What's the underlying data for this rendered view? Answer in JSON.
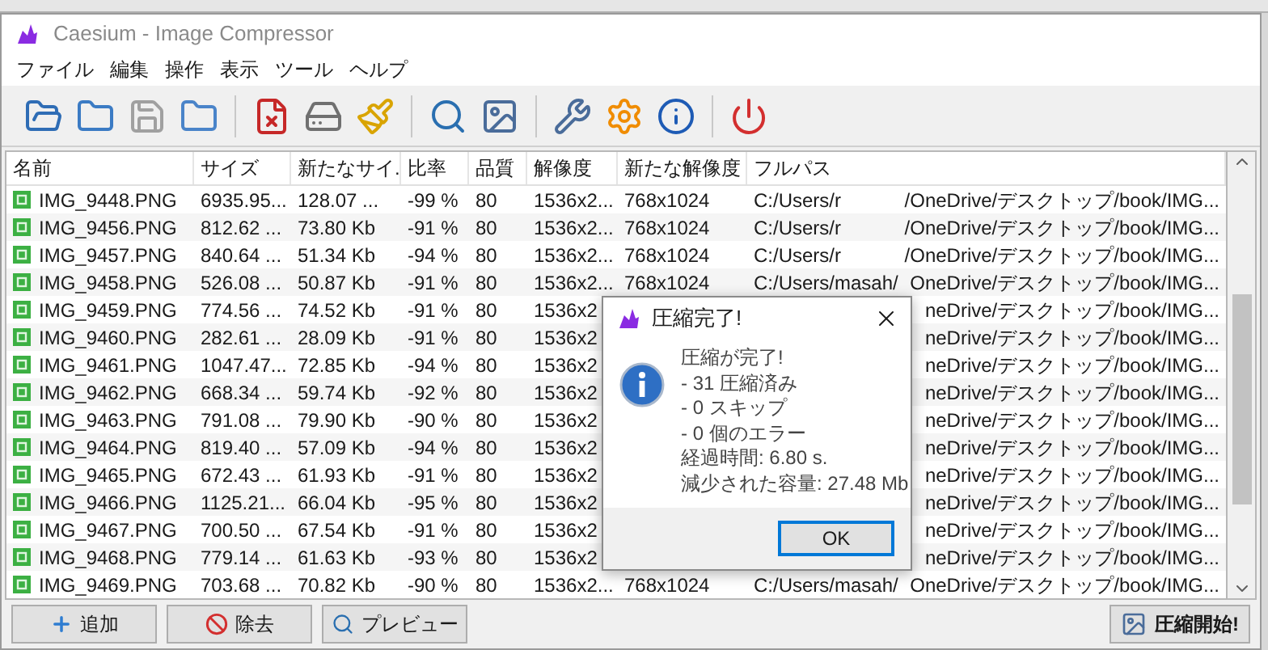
{
  "window": {
    "title": "Caesium - Image Compressor"
  },
  "menu": [
    "ファイル",
    "編集",
    "操作",
    "表示",
    "ツール",
    "ヘルプ"
  ],
  "table": {
    "columns": [
      "名前",
      "サイズ",
      "新たなサイ.",
      "比率",
      "品質",
      "解像度",
      "新たな解像度",
      "フルパス"
    ],
    "rows": [
      {
        "name": "IMG_9448.PNG",
        "size": "6935.95...",
        "new_size": "128.07 ...",
        "ratio": "-99 %",
        "quality": "80",
        "resolution": "1536x2...",
        "new_resolution": "768x1024",
        "path_start": "C:/Users/r",
        "path_end": "/OneDrive/デスクトップ/book/IMG..."
      },
      {
        "name": "IMG_9456.PNG",
        "size": "812.62 ...",
        "new_size": "73.80 Kb",
        "ratio": "-91 %",
        "quality": "80",
        "resolution": "1536x2...",
        "new_resolution": "768x1024",
        "path_start": "C:/Users/r",
        "path_end": "/OneDrive/デスクトップ/book/IMG..."
      },
      {
        "name": "IMG_9457.PNG",
        "size": "840.64 ...",
        "new_size": "51.34 Kb",
        "ratio": "-94 %",
        "quality": "80",
        "resolution": "1536x2...",
        "new_resolution": "768x1024",
        "path_start": "C:/Users/r",
        "path_end": "/OneDrive/デスクトップ/book/IMG..."
      },
      {
        "name": "IMG_9458.PNG",
        "size": "526.08 ...",
        "new_size": "50.87 Kb",
        "ratio": "-91 %",
        "quality": "80",
        "resolution": "1536x2...",
        "new_resolution": "768x1024",
        "path_start": "C:/Users/masah/",
        "path_end": "OneDrive/デスクトップ/book/IMG..."
      },
      {
        "name": "IMG_9459.PNG",
        "size": "774.56 ...",
        "new_size": "74.52 Kb",
        "ratio": "-91 %",
        "quality": "80",
        "resolution": "1536x2",
        "path_end": "neDrive/デスクトップ/book/IMG..."
      },
      {
        "name": "IMG_9460.PNG",
        "size": "282.61 ...",
        "new_size": "28.09 Kb",
        "ratio": "-91 %",
        "quality": "80",
        "resolution": "1536x2",
        "path_end": "neDrive/デスクトップ/book/IMG..."
      },
      {
        "name": "IMG_9461.PNG",
        "size": "1047.47...",
        "new_size": "72.85 Kb",
        "ratio": "-94 %",
        "quality": "80",
        "resolution": "1536x2",
        "path_end": "neDrive/デスクトップ/book/IMG..."
      },
      {
        "name": "IMG_9462.PNG",
        "size": "668.34 ...",
        "new_size": "59.74 Kb",
        "ratio": "-92 %",
        "quality": "80",
        "resolution": "1536x2",
        "path_end": "neDrive/デスクトップ/book/IMG..."
      },
      {
        "name": "IMG_9463.PNG",
        "size": "791.08 ...",
        "new_size": "79.90 Kb",
        "ratio": "-90 %",
        "quality": "80",
        "resolution": "1536x2",
        "path_end": "neDrive/デスクトップ/book/IMG..."
      },
      {
        "name": "IMG_9464.PNG",
        "size": "819.40 ...",
        "new_size": "57.09 Kb",
        "ratio": "-94 %",
        "quality": "80",
        "resolution": "1536x2",
        "path_end": "neDrive/デスクトップ/book/IMG..."
      },
      {
        "name": "IMG_9465.PNG",
        "size": "672.43 ...",
        "new_size": "61.93 Kb",
        "ratio": "-91 %",
        "quality": "80",
        "resolution": "1536x2",
        "path_end": "neDrive/デスクトップ/book/IMG..."
      },
      {
        "name": "IMG_9466.PNG",
        "size": "1125.21...",
        "new_size": "66.04 Kb",
        "ratio": "-95 %",
        "quality": "80",
        "resolution": "1536x2",
        "path_end": "neDrive/デスクトップ/book/IMG..."
      },
      {
        "name": "IMG_9467.PNG",
        "size": "700.50 ...",
        "new_size": "67.54 Kb",
        "ratio": "-91 %",
        "quality": "80",
        "resolution": "1536x2",
        "path_end": "neDrive/デスクトップ/book/IMG..."
      },
      {
        "name": "IMG_9468.PNG",
        "size": "779.14 ...",
        "new_size": "61.63 Kb",
        "ratio": "-93 %",
        "quality": "80",
        "resolution": "1536x2",
        "path_end": "neDrive/デスクトップ/book/IMG..."
      },
      {
        "name": "IMG_9469.PNG",
        "size": "703.68 ...",
        "new_size": "70.82 Kb",
        "ratio": "-90 %",
        "quality": "80",
        "resolution": "1536x2...",
        "new_resolution": "768x1024",
        "path_start": "C:/Users/masah/",
        "path_end": "OneDrive/デスクトップ/book/IMG..."
      }
    ]
  },
  "buttons": [
    {
      "kind": "add",
      "label": "追加"
    },
    {
      "kind": "remove",
      "label": "除去"
    },
    {
      "kind": "preview",
      "label": "プレビュー"
    }
  ],
  "compress_button": "圧縮開始!",
  "dialog": {
    "title": "圧縮完了!",
    "lines": [
      "圧縮が完了!",
      "- 31 圧縮済み",
      "- 0 スキップ",
      "- 0 個のエラー",
      "経過時間: 6.80 s.",
      "減少された容量: 27.48 Mb"
    ],
    "ok_button": "OK"
  }
}
